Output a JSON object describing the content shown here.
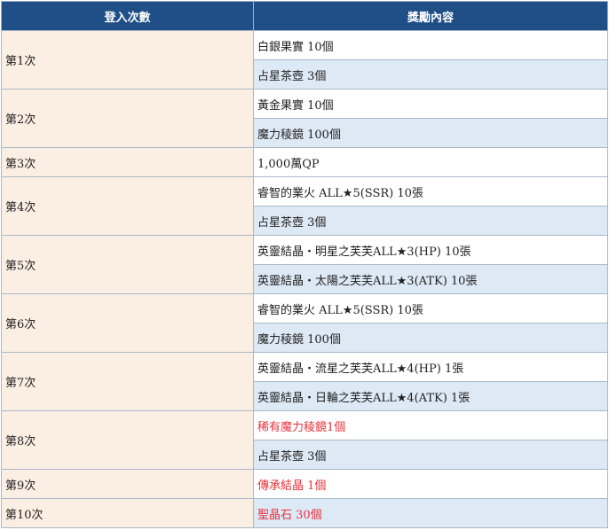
{
  "headers": {
    "login": "登入次數",
    "reward": "獎勵內容"
  },
  "colors": {
    "header_bg": "#1f4f86",
    "login_bg": "#fbeee3",
    "reward_alt_bg": "#dde9f5",
    "highlight_text": "#e8323c"
  },
  "rows": [
    {
      "login": "第1次",
      "rewards": [
        "白銀果實 10個",
        "占星茶壺 3個"
      ]
    },
    {
      "login": "第2次",
      "rewards": [
        "黃金果實 10個",
        "魔力稜鏡 100個"
      ]
    },
    {
      "login": "第3次",
      "rewards": [
        "1,000萬QP"
      ]
    },
    {
      "login": "第4次",
      "rewards": [
        "睿智的業火 ALL★5(SSR) 10張",
        "占星茶壺 3個"
      ]
    },
    {
      "login": "第5次",
      "rewards": [
        "英靈結晶・明星之芙芙ALL★3(HP) 10張",
        "英靈結晶・太陽之芙芙ALL★3(ATK) 10張"
      ]
    },
    {
      "login": "第6次",
      "rewards": [
        "睿智的業火 ALL★5(SSR) 10張",
        "魔力稜鏡 100個"
      ]
    },
    {
      "login": "第7次",
      "rewards": [
        "英靈結晶・流星之芙芙ALL★4(HP) 1張",
        "英靈結晶・日輪之芙芙ALL★4(ATK) 1張"
      ]
    },
    {
      "login": "第8次",
      "rewards": [
        "稀有魔力稜鏡1個",
        "占星茶壺 3個"
      ]
    },
    {
      "login": "第9次",
      "rewards": [
        "傳承結晶 1個"
      ]
    },
    {
      "login": "第10次",
      "rewards": [
        "聖晶石 30個"
      ]
    }
  ]
}
